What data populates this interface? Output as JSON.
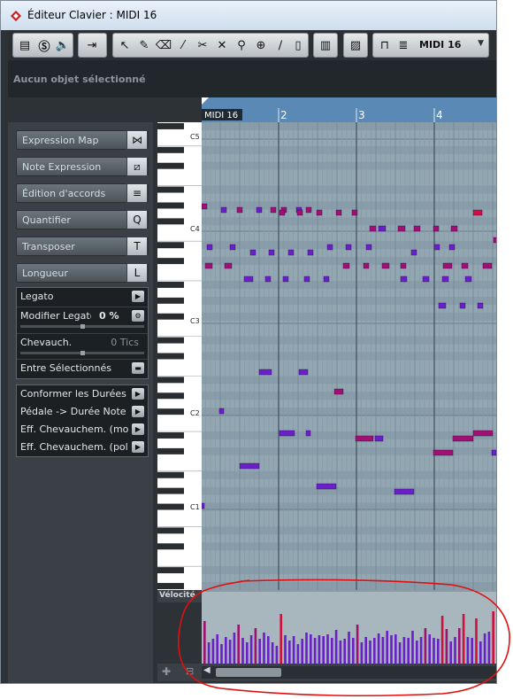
{
  "window": {
    "title": "Éditeur Clavier : MIDI 16"
  },
  "toolbar": {
    "track_name": "MIDI 16",
    "icons": [
      "inspector-toggle-icon",
      "solo-icon",
      "speaker-icon",
      "autoscroll-icon",
      "pointer-icon",
      "pencil-icon",
      "eraser-icon",
      "brush-icon",
      "scissors-icon",
      "mute-icon",
      "glue-icon",
      "zoom-icon",
      "line-icon",
      "play-marker-icon",
      "grid-icon",
      "color-icon",
      "track-icon",
      "list-icon"
    ]
  },
  "infoline": {
    "text": "Aucun objet sélectionné"
  },
  "inspector": {
    "sections": [
      {
        "label": "Expression Map",
        "icon": "expression-map-icon",
        "glyph": "⋈"
      },
      {
        "label": "Note Expression",
        "icon": "note-expression-icon",
        "glyph": "⧄"
      },
      {
        "label": "Édition d'accords",
        "icon": "chord-icon",
        "glyph": "≡"
      },
      {
        "label": "Quantifier",
        "icon": "quantize-icon",
        "glyph": "Q"
      },
      {
        "label": "Transposer",
        "icon": "transpose-icon",
        "glyph": "T"
      },
      {
        "label": "Longueur",
        "icon": "length-icon",
        "glyph": "L"
      }
    ],
    "length_panel": {
      "legato": "Legato",
      "modifier_label": "Modifier Legato",
      "modifier_value": "0 %",
      "overlap_label": "Chevauch.",
      "overlap_value": "0 Tics",
      "between_selected": "Entre Sélectionnés"
    },
    "functions": [
      "Conformer les Durées",
      "Pédale -> Durée Note",
      "Eff. Chevauchem. (mono)",
      "Eff. Chevauchem. (poly)"
    ]
  },
  "ruler": {
    "part_name": "MIDI 16",
    "bars": [
      "2",
      "3",
      "4"
    ]
  },
  "piano": {
    "labels": [
      "C5",
      "C4",
      "C3",
      "C2",
      "C1"
    ]
  },
  "controller_lane": {
    "label": "Vélocité"
  },
  "colors": {
    "annotation": "#e01010",
    "grid_bg": "#93a7b3",
    "ruler": "#5b89b5",
    "note_purple": "#6a1fc9",
    "note_magenta": "#a01070",
    "note_red": "#d0103c"
  }
}
